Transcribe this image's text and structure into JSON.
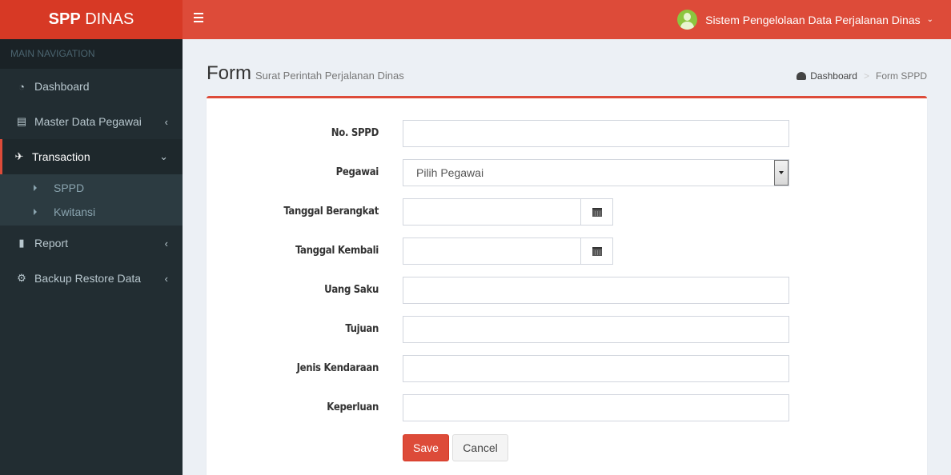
{
  "app": {
    "logo_bold": "SPP",
    "logo_rest": " DINAS",
    "user_label": "Sistem Pengelolaan Data Perjalanan Dinas"
  },
  "colors": {
    "brand": "#dd4b39",
    "brand_dark": "#d73925",
    "sidebar": "#222d32",
    "avatar": "#8cc63f"
  },
  "sidebar": {
    "header": "MAIN NAVIGATION",
    "items": [
      {
        "label": "Dashboard",
        "icon": "dashboard-icon"
      },
      {
        "label": "Master Data Pegawai",
        "icon": "book-icon"
      },
      {
        "label": "Transaction",
        "icon": "plane-icon",
        "active": true,
        "children": [
          {
            "label": "SPPD"
          },
          {
            "label": "Kwitansi"
          }
        ]
      },
      {
        "label": "Report",
        "icon": "file-icon"
      },
      {
        "label": "Backup Restore Data",
        "icon": "cogs-icon"
      }
    ]
  },
  "page": {
    "title": "Form",
    "subtitle": "Surat Perintah Perjalanan Dinas",
    "breadcrumb": [
      {
        "label": "Dashboard",
        "icon": "dashboard-icon"
      },
      {
        "label": "Form SPPD"
      }
    ],
    "breadcrumb_separator": ">"
  },
  "form": {
    "fields": [
      {
        "label": "No. SPPD",
        "type": "text",
        "value": ""
      },
      {
        "label": "Pegawai",
        "type": "select",
        "value": "Pilih Pegawai"
      },
      {
        "label": "Tanggal Berangkat",
        "type": "date",
        "value": ""
      },
      {
        "label": "Tanggal Kembali",
        "type": "date",
        "value": ""
      },
      {
        "label": "Uang Saku",
        "type": "text",
        "value": ""
      },
      {
        "label": "Tujuan",
        "type": "text",
        "value": ""
      },
      {
        "label": "Jenis Kendaraan",
        "type": "text",
        "value": ""
      },
      {
        "label": "Keperluan",
        "type": "text",
        "value": ""
      }
    ],
    "save_label": "Save",
    "cancel_label": "Cancel"
  }
}
